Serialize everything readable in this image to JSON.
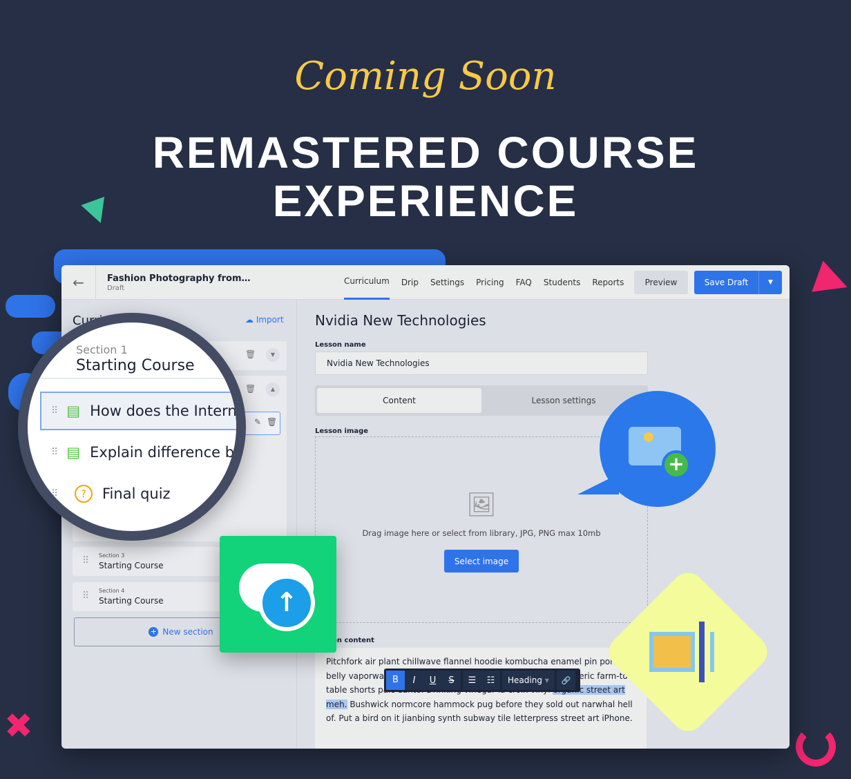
{
  "hero": {
    "coming_soon": "Coming Soon",
    "title_line1": "REMASTERED COURSE",
    "title_line2": "EXPERIENCE"
  },
  "header": {
    "course_title": "Fashion Photography from…",
    "status": "Draft",
    "tabs": [
      "Curriculum",
      "Drip",
      "Settings",
      "Pricing",
      "FAQ",
      "Students",
      "Reports"
    ],
    "active_tab": "Curriculum",
    "preview_label": "Preview",
    "save_label": "Save Draft"
  },
  "curriculum": {
    "heading": "Curriculum",
    "import_label": "Import",
    "sections": [
      {
        "label": "Section 1",
        "name": "Starting Course"
      },
      {
        "label": "Section 3",
        "name": "Starting Course"
      },
      {
        "label": "Section 4",
        "name": "Starting Course"
      }
    ],
    "lessons": [
      {
        "title": "How does the Internet work?",
        "type": "lesson"
      },
      {
        "title": "Explain difference between",
        "type": "lesson"
      },
      {
        "title": "Final quiz",
        "type": "quiz"
      }
    ],
    "new_section_label": "New section"
  },
  "lesson": {
    "heading": "Nvidia New Technologies",
    "name_label": "Lesson name",
    "name_value": "Nvidia New Technologies",
    "tabs": [
      "Content",
      "Lesson settings"
    ],
    "image_label": "Lesson image",
    "drop_hint": "Drag image here or select from library, JPG, PNG max 10mb",
    "select_image_label": "Select image",
    "content_label": "Lesson content",
    "content_before": "Pitchfork air plant chillwave flannel hoodie kombucha enamel pin pork belly vaporware four loko williamsburg aesthetic iceland tumeric farm-to-table shorts palo santo. Drinking vinegar la croix vinyl ",
    "content_selected": "organic street art meh.",
    "content_after": " Bushwick normcore hammock pug before they sold out narwhal hell of. Put a bird on it jianbing synth subway tile letterpress street art iPhone."
  },
  "toolbar": {
    "bold": "B",
    "italic": "I",
    "underline": "U",
    "strike": "S",
    "bullet": "☰",
    "ordered": "☷",
    "heading": "Heading",
    "link": "🔗"
  },
  "colors": {
    "background": "#262f45",
    "accent": "#2f73e8",
    "green": "#12d27a",
    "yellow": "#f7c948",
    "pink": "#f0266f"
  }
}
